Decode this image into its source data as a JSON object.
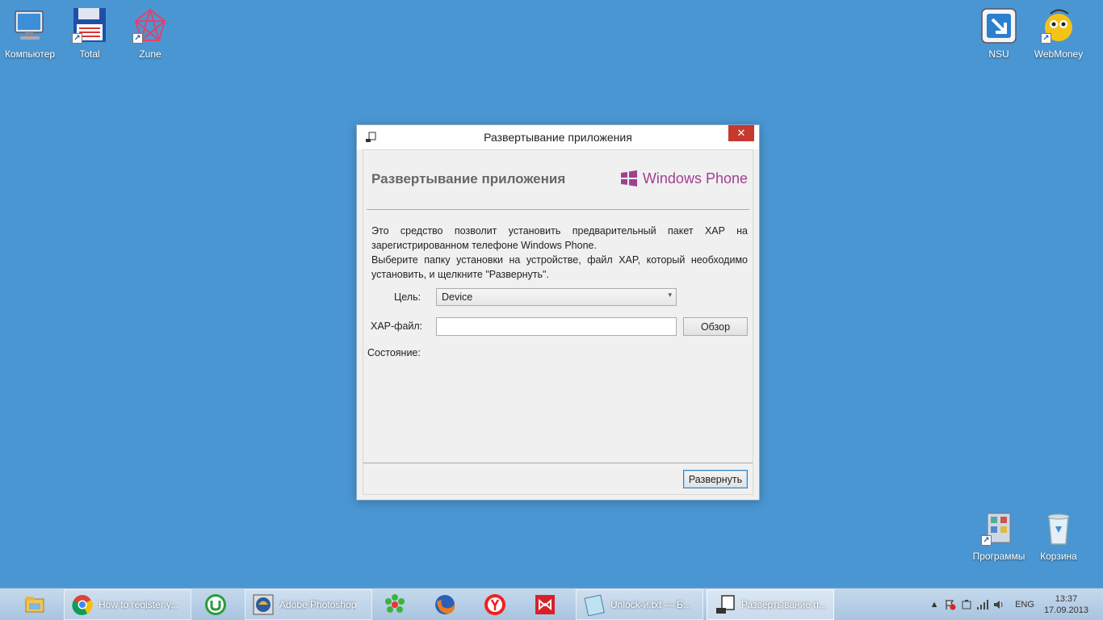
{
  "desktop": {
    "icons": [
      {
        "label": "Компьютер",
        "icon": "computer-icon"
      },
      {
        "label": "Total",
        "icon": "total-commander-icon"
      },
      {
        "label": "Zune",
        "icon": "zune-icon"
      },
      {
        "label": "NSU",
        "icon": "nsu-icon"
      },
      {
        "label": "WebMoney",
        "icon": "webmoney-icon"
      },
      {
        "label": "Программы",
        "icon": "programs-folder-icon"
      },
      {
        "label": "Корзина",
        "icon": "recycle-bin-icon"
      }
    ]
  },
  "dialog": {
    "title": "Развертывание приложения",
    "close_label": "✕",
    "header_title": "Развертывание приложения",
    "brand": "Windows Phone",
    "description": "Это средство позволит установить предварительный пакет XAP на зарегистрированном телефоне Windows Phone.",
    "description2": "Выберите папку установки на устройстве, файл XAP, который необходимо установить, и щелкните \"Развернуть\".",
    "target_label": "Цель:",
    "target_value": "Device",
    "xap_label": "XAP-файл:",
    "xap_value": "",
    "browse_label": "Обзор",
    "status_label": "Состояние:",
    "deploy_label": "Развернуть",
    "brand_color": "#a0418f"
  },
  "taskbar": {
    "items": [
      {
        "label": "",
        "icon": "file-explorer-icon"
      },
      {
        "label": "How to register y...",
        "icon": "chrome-icon"
      },
      {
        "label": "",
        "icon": "utorrent-icon"
      },
      {
        "label": "Adobe Photoshop",
        "icon": "photoshop-icon"
      },
      {
        "label": "",
        "icon": "icq-icon"
      },
      {
        "label": "",
        "icon": "firefox-icon"
      },
      {
        "label": "",
        "icon": "yandex-icon"
      },
      {
        "label": "",
        "icon": "visual-studio-icon"
      },
      {
        "label": "Unlock-и.txt — Б...",
        "icon": "notepad-icon"
      },
      {
        "label": "Развертывание п...",
        "icon": "deploy-app-icon"
      }
    ],
    "tray": {
      "language": "ENG",
      "time": "13:37",
      "date": "17.09.2013"
    }
  }
}
